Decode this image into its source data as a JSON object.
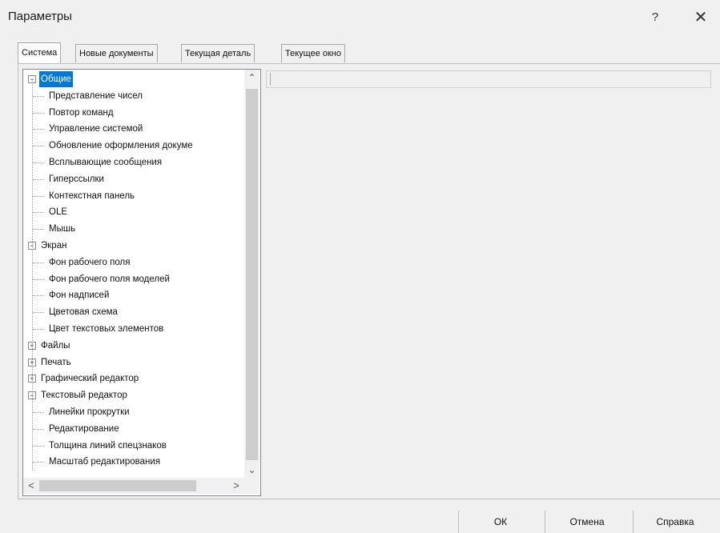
{
  "window": {
    "title": "Параметры",
    "help_glyph": "?",
    "close_glyph": "✕"
  },
  "tabs": [
    {
      "label": "Система",
      "active": true
    },
    {
      "label": "Новые документы",
      "active": false
    },
    {
      "label": "Текущая деталь",
      "active": false
    },
    {
      "label": "Текущее окно",
      "active": false
    }
  ],
  "tree": {
    "items": [
      {
        "label": "Общие",
        "level": 0,
        "expander": "minus",
        "selected": true
      },
      {
        "label": "Представление чисел",
        "level": 1
      },
      {
        "label": "Повтор команд",
        "level": 1
      },
      {
        "label": "Управление системой",
        "level": 1
      },
      {
        "label": "Обновление оформления докуме",
        "level": 1
      },
      {
        "label": "Всплывающие сообщения",
        "level": 1
      },
      {
        "label": "Гиперссылки",
        "level": 1
      },
      {
        "label": "Контекстная панель",
        "level": 1
      },
      {
        "label": "OLE",
        "level": 1
      },
      {
        "label": "Мышь",
        "level": 1
      },
      {
        "label": "Экран",
        "level": 0,
        "expander": "minus"
      },
      {
        "label": "Фон рабочего поля",
        "level": 1
      },
      {
        "label": "Фон рабочего поля моделей",
        "level": 1
      },
      {
        "label": "Фон надписей",
        "level": 1
      },
      {
        "label": "Цветовая схема",
        "level": 1
      },
      {
        "label": "Цвет текстовых элементов",
        "level": 1
      },
      {
        "label": "Файлы",
        "level": 0,
        "expander": "plus"
      },
      {
        "label": "Печать",
        "level": 0,
        "expander": "plus"
      },
      {
        "label": "Графический редактор",
        "level": 0,
        "expander": "plus"
      },
      {
        "label": "Текстовый редактор",
        "level": 0,
        "expander": "minus"
      },
      {
        "label": "Линейки прокрутки",
        "level": 1
      },
      {
        "label": "Редактирование",
        "level": 1
      },
      {
        "label": "Толщина линий спецзнаков",
        "level": 1
      },
      {
        "label": "Масштаб редактирования",
        "level": 1
      }
    ]
  },
  "scroll": {
    "up": "⌃",
    "down": "⌄",
    "left": "<",
    "right": ">"
  },
  "buttons": {
    "ok": "ОК",
    "cancel": "Отмена",
    "help": "Справка"
  },
  "colors": {
    "selection": "#0078d7",
    "background": "#f0f0f0"
  }
}
